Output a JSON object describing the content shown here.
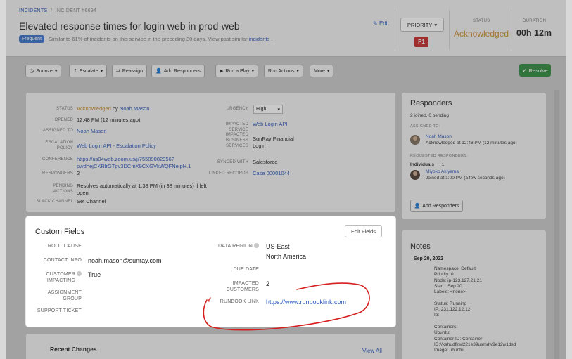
{
  "header": {
    "breadcrumb_link": "INCIDENTS",
    "breadcrumb_id": "INCIDENT #6694",
    "title": "Elevated response times for login web in prod-web",
    "frequent_badge": "Frequent",
    "frequent_text": "Similar to 61% of incidents on this service in the preceding 30 days. View past similar",
    "frequent_link": "incidents",
    "frequent_tail": ".",
    "edit_label": "Edit",
    "priority_label": "PRIORITY",
    "priority_value": "P1",
    "status_label": "STATUS",
    "status_value": "Acknowledged",
    "duration_label": "DURATION",
    "duration_value": "00h 12m"
  },
  "toolbar": {
    "snooze": "Snooze",
    "escalate": "Escalate",
    "reassign": "Reassign",
    "add_responders": "Add Responders",
    "run_play": "Run a Play",
    "run_actions": "Run Actions",
    "more": "More",
    "resolve": "Resolve"
  },
  "details": {
    "status_label": "STATUS",
    "status_value": "Acknowledged",
    "status_by": "by",
    "status_user": "Noah Mason",
    "opened_label": "OPENED",
    "opened_value": "12:48 PM (12 minutes ago)",
    "assigned_label": "ASSIGNED TO",
    "assigned_value": "Noah Mason",
    "escalation_label1": "ESCALATION",
    "escalation_label2": "POLICY",
    "escalation_value": "Web Login API - Escalation Policy",
    "conference_label": "CONFERENCE",
    "conference_value1": "https://us04web.zoom.us/j/75589082956?",
    "conference_value2": "pwd=ejCKRlrGTgv3DCmX9CXGVkWQFNejpH.1",
    "responders_label": "RESPONDERS",
    "responders_value": "2",
    "pending_label": "PENDING ACTIONS",
    "pending_value1": "Resolves automatically at 1:38 PM (in 38 minutes) if left",
    "pending_value2": "open.",
    "slack_label": "SLACK CHANNEL",
    "slack_value": "Set Channel",
    "urgency_label": "URGENCY",
    "urgency_value": "High",
    "impacted_service_label": "IMPACTED SERVICE",
    "impacted_service_value": "Web Login API",
    "impacted_bs_label1": "IMPACTED",
    "impacted_bs_label2": "BUSINESS",
    "impacted_bs_label3": "SERVICES",
    "impacted_bs_value1": "SunRay Financial",
    "impacted_bs_value2": "Login",
    "synced_label": "SYNCED WITH",
    "synced_value": "Salesforce",
    "linked_label": "LINKED RECORDS",
    "linked_value": "Case 00001044"
  },
  "custom_fields": {
    "title": "Custom Fields",
    "edit_button": "Edit Fields",
    "root_cause_label": "ROOT CAUSE",
    "contact_info_label": "CONTACT INFO",
    "contact_info_value": "noah.mason@sunray.com",
    "customer_impacting_label1": "CUSTOMER",
    "customer_impacting_label2": "IMPACTING",
    "customer_impacting_value": "True",
    "assignment_group_label1": "ASSIGNMENT",
    "assignment_group_label2": "GROUP",
    "support_ticket_label": "SUPPORT TICKET",
    "data_region_label": "DATA REGION",
    "data_region_value1": "US-East",
    "data_region_value2": "North America",
    "due_date_label": "DUE DATE",
    "impacted_customers_label1": "IMPACTED",
    "impacted_customers_label2": "CUSTOMERS",
    "impacted_customers_value": "2",
    "runbook_label": "RUNBOOK LINK",
    "runbook_value": "https://www.runbooklink.com"
  },
  "recent_changes": {
    "title": "Recent Changes",
    "view_all": "View All"
  },
  "responders": {
    "title": "Responders",
    "summary": "2 joined, 0 pending",
    "assigned_label": "ASSIGNED TO:",
    "assigned_name": "Noah Mason",
    "assigned_detail": "Acknowledged at 12:48 PM (12 minutes ago)",
    "requested_label": "REQUESTED RESPONDERS:",
    "individuals_label": "Individuals",
    "individuals_count": "1",
    "requested_name": "Miyoko Akiyama",
    "requested_detail": "Joined at 1:00 PM (a few seconds ago)",
    "add_button": "Add Responders"
  },
  "notes": {
    "title": "Notes",
    "date": "Sep 20, 2022",
    "lines": [
      "Namespace: Default",
      "Priority: 0",
      "Node: ip-123.127.21.21",
      "Start : Sep 20",
      "Labels: <none>",
      "",
      "Status: Running",
      "IP: 231.122.12.12",
      "Ip:",
      "",
      "Containers:",
      "Ubuntu:",
      "Container ID: Container",
      "ID://kahudfkwl221e39usmdw9e12w1dsd",
      "Image: ubuntu"
    ]
  },
  "colors": {
    "link": "#2a56b8",
    "acknowledged": "#c98a2c",
    "priority_p1": "#c52a2a",
    "resolve": "#2e8a3c",
    "annotation": "#d62020"
  }
}
